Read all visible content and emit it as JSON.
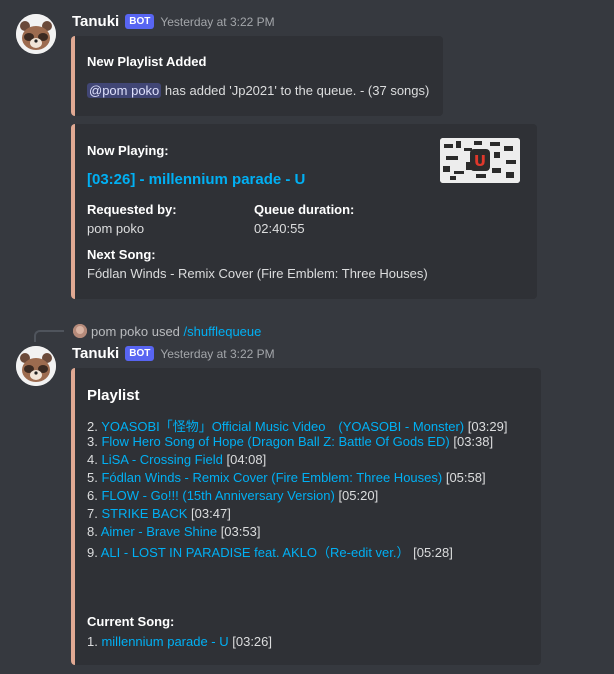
{
  "message1": {
    "username": "Tanuki",
    "badge": "BOT",
    "timestamp": "Yesterday at 3:22 PM"
  },
  "embed1": {
    "title": "New Playlist Added",
    "mention": "@pom poko",
    "text": " has added 'Jp2021' to the queue. - (37 songs)"
  },
  "embed2": {
    "label": "Now Playing:",
    "track_link": "[03:26] - millennium parade - U",
    "requested_label": "Requested by:",
    "requested_value": "pom poko",
    "queue_label": "Queue duration:",
    "queue_value": "02:40:55",
    "next_label": "Next Song:",
    "next_value": "Fódlan Winds - Remix Cover (Fire Emblem: Three Houses)",
    "thumbnail_letter": "U"
  },
  "reply": {
    "user": "pom poko",
    "used": "used",
    "command": "/shufflequeue"
  },
  "message2": {
    "username": "Tanuki",
    "badge": "BOT",
    "timestamp": "Yesterday at 3:22 PM"
  },
  "playlist": {
    "title": "Playlist",
    "items": [
      {
        "num": "2.",
        "title": "YOASOBI「怪物」Official Music Video　(YOASOBI - Monster)",
        "dur": " [03:29]"
      },
      {
        "num": "3.",
        "title": "Flow Hero Song of Hope (Dragon Ball Z: Battle Of Gods ED)",
        "dur": " [03:38]"
      },
      {
        "num": "4.",
        "title": "LiSA - Crossing Field",
        "dur": " [04:08]"
      },
      {
        "num": "5.",
        "title": "Fódlan Winds - Remix Cover (Fire Emblem: Three Houses)",
        "dur": " [05:58]"
      },
      {
        "num": "6.",
        "title": "FLOW - Go!!! (15th Anniversary Version)",
        "dur": " [05:20]"
      },
      {
        "num": "7.",
        "title": "STRIKE BACK",
        "dur": " [03:47]"
      },
      {
        "num": "8.",
        "title": "Aimer - Brave Shine",
        "dur": " [03:53]"
      },
      {
        "num": "9.",
        "title": "ALI - LOST IN PARADISE feat. AKLO（Re-edit ver.）",
        "dur": "  [05:28]"
      }
    ],
    "current_label": "Current Song:",
    "current": {
      "num": "1.",
      "title": "millennium parade - U",
      "dur": " [03:26]"
    }
  },
  "colors": {
    "background": "#36393f",
    "embed_bg": "#2f3136",
    "embed_border": "#e0a993",
    "link": "#00b0f4",
    "bot_badge": "#5865f2"
  }
}
